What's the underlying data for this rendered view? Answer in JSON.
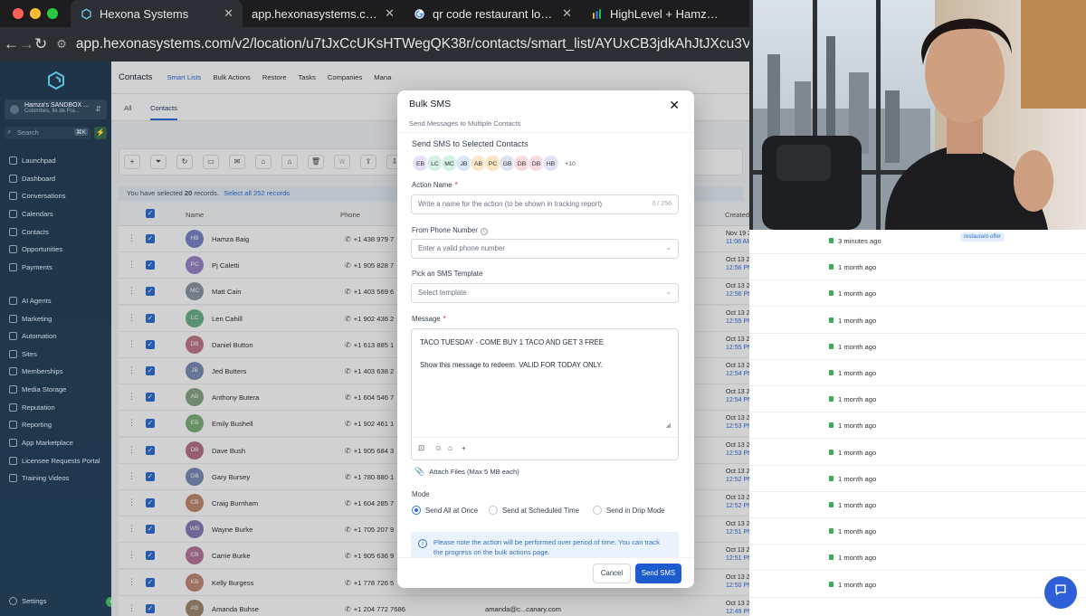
{
  "browser": {
    "traffic_colors": [
      "#ff5f57",
      "#febc2e",
      "#28c840"
    ],
    "tabs": [
      {
        "label": "Hexona Systems",
        "favicon": "hexona-logo-icon"
      },
      {
        "label": "app.hexonasystems.com/v2/l",
        "favicon": "none"
      },
      {
        "label": "qr code restaurant loyalty pro",
        "favicon": "google-icon"
      },
      {
        "label": "HighLevel + Hamza Baig's Sp",
        "favicon": "highlevel-icon"
      }
    ],
    "url": "app.hexonasystems.com/v2/location/u7tJxCcUKsHTWegQK38r/contacts/smart_list/AYUxCB3jdkAhJtJXcu3V"
  },
  "sidebar": {
    "account_name": "Hamza's SANDBOX ...",
    "account_location": "Colombes, Ile de Fra...",
    "search_placeholder": "Search",
    "search_shortcut": "⌘K",
    "items": [
      "Launchpad",
      "Dashboard",
      "Conversations",
      "Calendars",
      "Contacts",
      "Opportunities",
      "Payments",
      "AI Agents",
      "Marketing",
      "Automation",
      "Sites",
      "Memberships",
      "Media Storage",
      "Reputation",
      "Reporting",
      "App Marketplace",
      "Licensee Requests Portal",
      "Training Videos"
    ],
    "settings": "Settings"
  },
  "contacts": {
    "title": "Contacts",
    "nav": [
      "Smart Lists",
      "Bulk Actions",
      "Restore",
      "Tasks",
      "Companies",
      "Mana"
    ],
    "tabs": [
      "All",
      "Contacts"
    ],
    "selection_text": "You have selected",
    "selected_count": "20",
    "records": "records.",
    "select_all": "Select all 252 records",
    "col_name": "Name",
    "col_phone": "Phone",
    "col_created": "Created",
    "rows": [
      {
        "initials": "HB",
        "name": "Hamza Baig",
        "phone": "+1 438 979 7",
        "color": "#7b86c8"
      },
      {
        "initials": "PC",
        "name": "Pj Caletti",
        "phone": "+1 905 828 7",
        "color": "#9b87c7"
      },
      {
        "initials": "MC",
        "name": "Matt Cain",
        "phone": "+1 403 569 6",
        "color": "#8d98a8"
      },
      {
        "initials": "LC",
        "name": "Len Cahill",
        "phone": "+1 902 436 2",
        "color": "#6cb38a"
      },
      {
        "initials": "DB",
        "name": "Daniel Button",
        "phone": "+1 613 885 1",
        "color": "#c27a8a"
      },
      {
        "initials": "JB",
        "name": "Jed Butters",
        "phone": "+1 403 638 2",
        "color": "#7a8fb7"
      },
      {
        "initials": "AB",
        "name": "Anthony Butera",
        "phone": "+1 604 546 7",
        "color": "#8aa889"
      },
      {
        "initials": "EB",
        "name": "Emily Bushell",
        "phone": "+1 902 461 1",
        "color": "#7db37d"
      },
      {
        "initials": "DB",
        "name": "Dave Bush",
        "phone": "+1 905 684 3",
        "color": "#b8738a"
      },
      {
        "initials": "GB",
        "name": "Gary Bursey",
        "phone": "+1 780 880 1",
        "color": "#7a8db8"
      },
      {
        "initials": "CB",
        "name": "Craig Burnham",
        "phone": "+1 604 285 7",
        "color": "#c38a6e"
      },
      {
        "initials": "WB",
        "name": "Wayne Burke",
        "phone": "+1 705 207 9",
        "color": "#8d7db8"
      },
      {
        "initials": "CB",
        "name": "Carrie Burke",
        "phone": "+1 905 636 9",
        "color": "#b77a9d"
      },
      {
        "initials": "KB",
        "name": "Kelly Burgess",
        "phone": "+1 778 726 5",
        "color": "#c58a7a"
      },
      {
        "initials": "AB",
        "name": "Amanda Buhse",
        "phone": "+1 204 772 7686",
        "color": "#a08a6e",
        "email": "amanda@c...canary.com"
      }
    ],
    "created": [
      {
        "date": "Nov 19 2025",
        "time": "11:08 AM",
        "ago": "3 minutes ago"
      },
      {
        "date": "Oct 13 2025",
        "time": "12:56 PM",
        "ago": "1 month ago"
      },
      {
        "date": "Oct 13 2025",
        "time": "12:56 PM",
        "ago": "1 month ago"
      },
      {
        "date": "Oct 13 2025",
        "time": "12:55 PM",
        "ago": "1 month ago"
      },
      {
        "date": "Oct 13 2025",
        "time": "12:55 PM",
        "ago": "1 month ago"
      },
      {
        "date": "Oct 13 2025",
        "time": "12:54 PM",
        "ago": "1 month ago"
      },
      {
        "date": "Oct 13 2025",
        "time": "12:54 PM",
        "ago": "1 month ago"
      },
      {
        "date": "Oct 13 2025",
        "time": "12:53 PM",
        "ago": "1 month ago"
      },
      {
        "date": "Oct 13 2025",
        "time": "12:53 PM",
        "ago": "1 month ago"
      },
      {
        "date": "Oct 13 2025",
        "time": "12:52 PM",
        "ago": "1 month ago"
      },
      {
        "date": "Oct 13 2025",
        "time": "12:52 PM",
        "ago": "1 month ago"
      },
      {
        "date": "Oct 13 2025",
        "time": "12:51 PM",
        "ago": "1 month ago"
      },
      {
        "date": "Oct 13 2025",
        "time": "12:51 PM",
        "ago": "1 month ago"
      },
      {
        "date": "Oct 13 2025",
        "time": "12:50 PM",
        "ago": "1 month ago"
      },
      {
        "date": "Oct 13 2025",
        "time": "12:49 PM",
        "ago": ""
      }
    ],
    "tz": "(PST)",
    "tag": "restaurant-offer"
  },
  "modal": {
    "title": "Bulk SMS",
    "subtitle": "Send Messages to Multiple Contacts",
    "selected_heading": "Send SMS to Selected Contacts",
    "chips": [
      {
        "initials": "EB",
        "color": "#e8e0f5"
      },
      {
        "initials": "LC",
        "color": "#d6f0e6"
      },
      {
        "initials": "MC",
        "color": "#d4f2e4"
      },
      {
        "initials": "JB",
        "color": "#d8e6f8"
      },
      {
        "initials": "AB",
        "color": "#fbe8c8"
      },
      {
        "initials": "PC",
        "color": "#fce5c3"
      },
      {
        "initials": "GB",
        "color": "#dde4f0"
      },
      {
        "initials": "DB",
        "color": "#fadadd"
      },
      {
        "initials": "DB",
        "color": "#f6dbe3"
      },
      {
        "initials": "HB",
        "color": "#e2e4f4"
      }
    ],
    "more": "+10",
    "action_name_label": "Action Name",
    "action_name_placeholder": "Write a name for the action (to be shown in tracking report)",
    "action_name_count": "0 / 256",
    "from_phone_label": "From Phone Number",
    "from_phone_placeholder": "Enter a valid phone number",
    "template_label": "Pick an SMS Template",
    "template_placeholder": "Select template",
    "message_label": "Message",
    "message_line1": "TACO TUESDAY - COME BUY 1 TACO AND GET 3 FREE",
    "message_line2": "Show this message to redeem. VALID FOR TODAY ONLY.",
    "attach": "Attach Files (Max 5 MB each)",
    "mode_label": "Mode",
    "mode_options": [
      "Send All at Once",
      "Send at Scheduled Time",
      "Send in Drip Mode"
    ],
    "notice": "Please note the action will be performed over period of time. You can track the progress on the bulk actions page.",
    "cancel": "Cancel",
    "send": "Send SMS"
  }
}
